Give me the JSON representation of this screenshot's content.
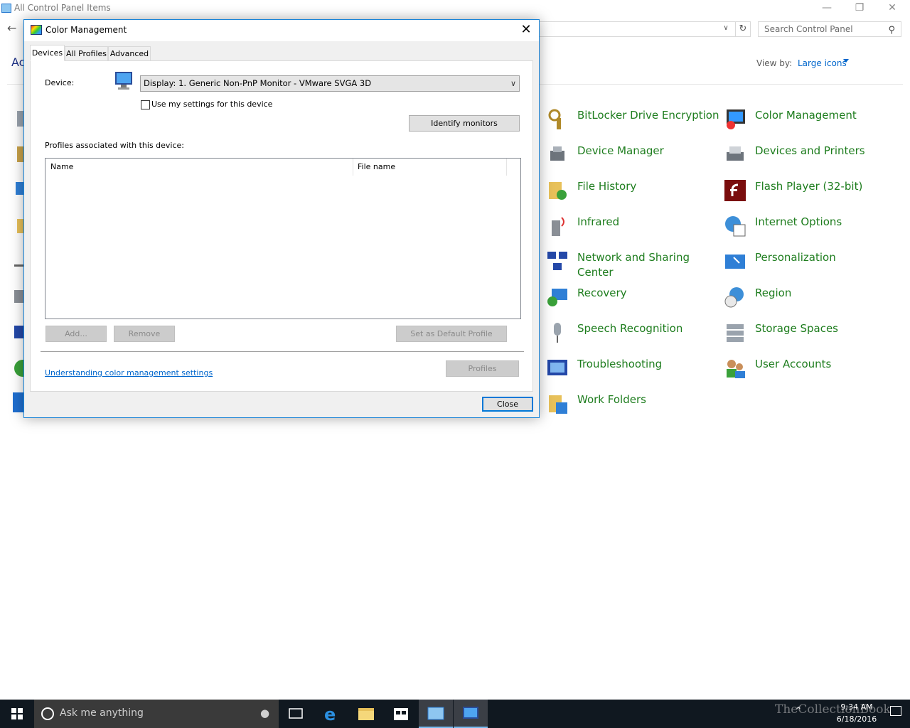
{
  "window": {
    "title": "All Control Panel Items",
    "search_placeholder": "Search Control Panel",
    "header_text": "Ac",
    "view_by_label": "View by:",
    "view_by_value": "Large icons"
  },
  "items": [
    {
      "label": "BitLocker Drive Encryption",
      "icon": "bitlocker-icon"
    },
    {
      "label": "Color Management",
      "icon": "color-management-icon"
    },
    {
      "label": "Device Manager",
      "icon": "device-manager-icon"
    },
    {
      "label": "Devices and Printers",
      "icon": "devices-printers-icon"
    },
    {
      "label": "File History",
      "icon": "file-history-icon"
    },
    {
      "label": "Flash Player (32-bit)",
      "icon": "flash-player-icon"
    },
    {
      "label": "Infrared",
      "icon": "infrared-icon"
    },
    {
      "label": "Internet Options",
      "icon": "internet-options-icon"
    },
    {
      "label": "Network and Sharing Center",
      "icon": "network-sharing-icon"
    },
    {
      "label": "Personalization",
      "icon": "personalization-icon"
    },
    {
      "label": "Recovery",
      "icon": "recovery-icon"
    },
    {
      "label": "Region",
      "icon": "region-icon"
    },
    {
      "label": "Speech Recognition",
      "icon": "speech-recognition-icon"
    },
    {
      "label": "Storage Spaces",
      "icon": "storage-spaces-icon"
    },
    {
      "label": "Troubleshooting",
      "icon": "troubleshooting-icon"
    },
    {
      "label": "User Accounts",
      "icon": "user-accounts-icon"
    },
    {
      "label": "Work Folders",
      "icon": "work-folders-icon"
    }
  ],
  "dialog": {
    "title": "Color Management",
    "tabs": [
      "Devices",
      "All Profiles",
      "Advanced"
    ],
    "device_label": "Device:",
    "device_value": "Display: 1. Generic Non-PnP Monitor - VMware SVGA 3D",
    "use_settings_label": "Use my settings for this device",
    "use_settings_checked": false,
    "identify_button": "Identify monitors",
    "profiles_label": "Profiles associated with this device:",
    "columns": [
      "Name",
      "File name"
    ],
    "add_button": "Add...",
    "remove_button": "Remove",
    "set_default_button": "Set as Default Profile",
    "link_text": "Understanding color management settings",
    "profiles_button": "Profiles",
    "close_button": "Close"
  },
  "taskbar": {
    "search_placeholder": "Ask me anything",
    "time": "9:34 AM",
    "date": "6/18/2016",
    "watermark": "TheCollectionBook"
  },
  "colors": {
    "link_green": "#1e7d1e",
    "accent": "#0078d7",
    "taskbar": "#101820"
  }
}
